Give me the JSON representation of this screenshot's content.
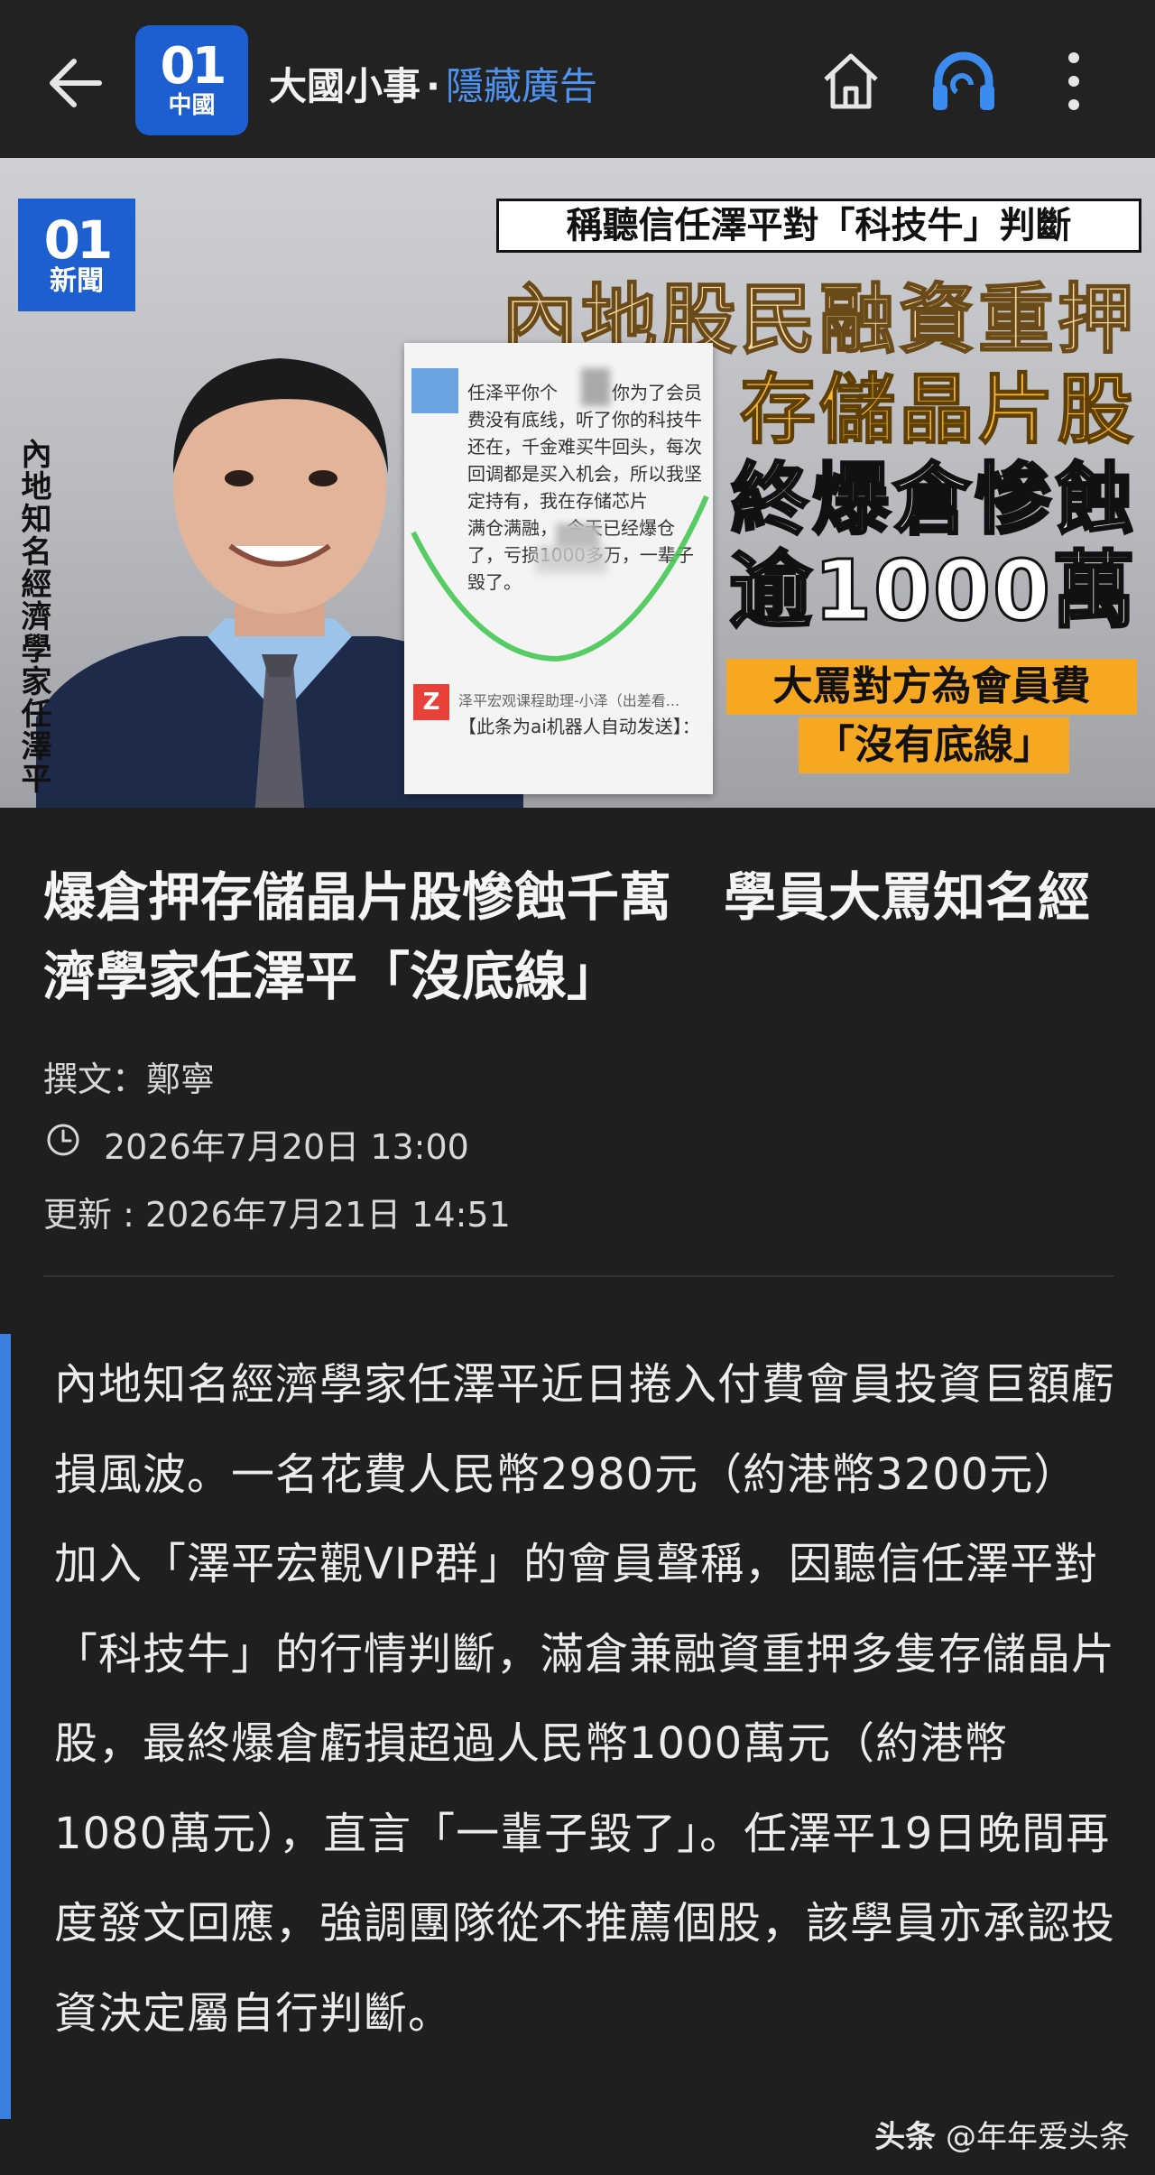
{
  "appbar": {
    "logo_top": "01",
    "logo_bottom": "中國",
    "channel_name": "大國小事",
    "separator": "·",
    "hide_ad": "隱藏廣告"
  },
  "hero": {
    "logo_top": "01",
    "logo_bottom": "新聞",
    "vertical_caption": "內地知名經濟學家任澤平",
    "headline_small": "稱聽信任澤平對「科技牛」判斷",
    "line1": "內地股民融資重押",
    "line2": "存儲晶片股",
    "line3": "終爆倉慘蝕",
    "line4": "逾1000萬",
    "orange1": "大罵對方為會員費",
    "orange2": "「沒有底線」",
    "chat_message": "任泽平你个　　　你为了会员费没有底线，听了你的科技牛还在，千金难买牛回头，每次回调都是买入机会，所以我坚定持有，我在存储芯片　　　满仓满融，　今天已经爆仓了，亏损1000多万，一辈子毁了。",
    "chat_sender": "泽平宏观课程助理-小泽（出差看...",
    "chat_auto": "【此条为ai机器人自动发送】："
  },
  "article": {
    "title": "爆倉押存儲晶片股慘蝕千萬　學員大罵知名經濟學家任澤平「沒底線」",
    "byline": "撰文：鄭寧",
    "published": "2026年7月20日 13:00",
    "updated": "更新 : 2026年7月21日 14:51",
    "lead": "內地知名經濟學家任澤平近日捲入付費會員投資巨額虧損風波。一名花費人民幣2980元（約港幣3200元）加入「澤平宏觀VIP群」的會員聲稱，因聽信任澤平對「科技牛」的行情判斷，滿倉兼融資重押多隻存儲晶片股，最終爆倉虧損超過人民幣1000萬元（約港幣1080萬元），直言「一輩子毀了」。任澤平19日晚間再度發文回應，強調團隊從不推薦個股，該學員亦承認投資決定屬自行判斷。"
  },
  "watermark": {
    "brand": "头条",
    "handle": "@年年爱头条"
  },
  "colors": {
    "accent_blue": "#4f93f0",
    "logo_blue": "#1d5fd0",
    "quote_bar": "#3b7fe0",
    "background": "#1f1f1f"
  }
}
